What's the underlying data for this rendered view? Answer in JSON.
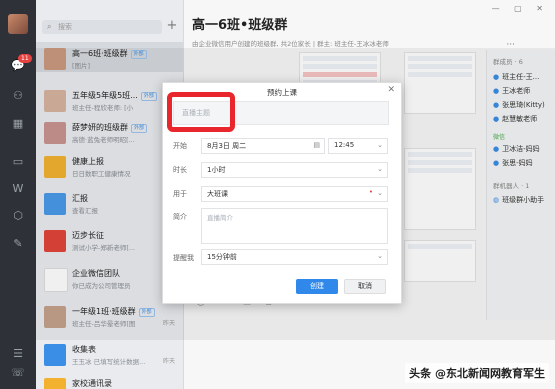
{
  "rail": {
    "chat_badge": "11"
  },
  "search": {
    "placeholder": "搜索"
  },
  "conversations": [
    {
      "title": "高一6班·班级群",
      "tag": "外部",
      "sub": "[图片]",
      "time": ""
    },
    {
      "title": "五年级5年级5班...",
      "tag": "外部",
      "sub": "班主任-程欣老师: [小",
      "time": ""
    },
    {
      "title": "薛梦妍的班级群",
      "tag": "外部",
      "sub": "高德·蓝兔老师明昭[...",
      "time": ""
    },
    {
      "title": "健康上报",
      "tag": "",
      "sub": "日日数职工健康情况",
      "time": ""
    },
    {
      "title": "汇报",
      "tag": "",
      "sub": "查看汇报",
      "time": ""
    },
    {
      "title": "迈步长征",
      "tag": "",
      "sub": "测试小学-郑新老师[...",
      "time": ""
    },
    {
      "title": "企业微信团队",
      "tag": "",
      "sub": "你已成为公司管理员",
      "time": ""
    },
    {
      "title": "一年级1班·班级群",
      "tag": "外部",
      "sub": "班主任-吕华晕老师[图",
      "time": "昨天"
    },
    {
      "title": "收集表",
      "tag": "",
      "sub": "王玉冰 已填写统计数据...",
      "time": "昨天"
    },
    {
      "title": "家校通讯录",
      "tag": "",
      "sub": "",
      "time": ""
    }
  ],
  "main": {
    "title": "高一6班•班级群",
    "subtitle": "由企业微信用户创建的班级群, 共2位家长  |  群主: 班主任-王冰冰老师",
    "more": "···"
  },
  "members": {
    "header": "群成员 · 6",
    "list": [
      "班主任-王...",
      "王冰老师",
      "张思琦(Kitty)",
      "赵慧敏老师"
    ],
    "wechat_label": "微信",
    "wechat_list": [
      "卫冰洁-妈妈",
      "张思-妈妈"
    ],
    "bots_header": "群机器人 · 1",
    "bot": "班级群小助手"
  },
  "dialog": {
    "title": "预约上课",
    "theme_placeholder": "直播主题",
    "start_label": "开始",
    "start_date": "8月3日 周二",
    "start_time": "12:45",
    "duration_label": "时长",
    "duration_value": "1小时",
    "use_label": "用于",
    "use_value": "大班课",
    "intro_label": "简介",
    "intro_placeholder": "直播简介",
    "remind_label": "提醒我",
    "remind_value": "15分钟前",
    "create_button": "创建",
    "cancel_button": "取消"
  },
  "watermark": "头条 @东北新闻网教育军生",
  "colors": {
    "accent": "#2f88ea",
    "highlight": "#e8262b",
    "rail": "#2e3238"
  }
}
